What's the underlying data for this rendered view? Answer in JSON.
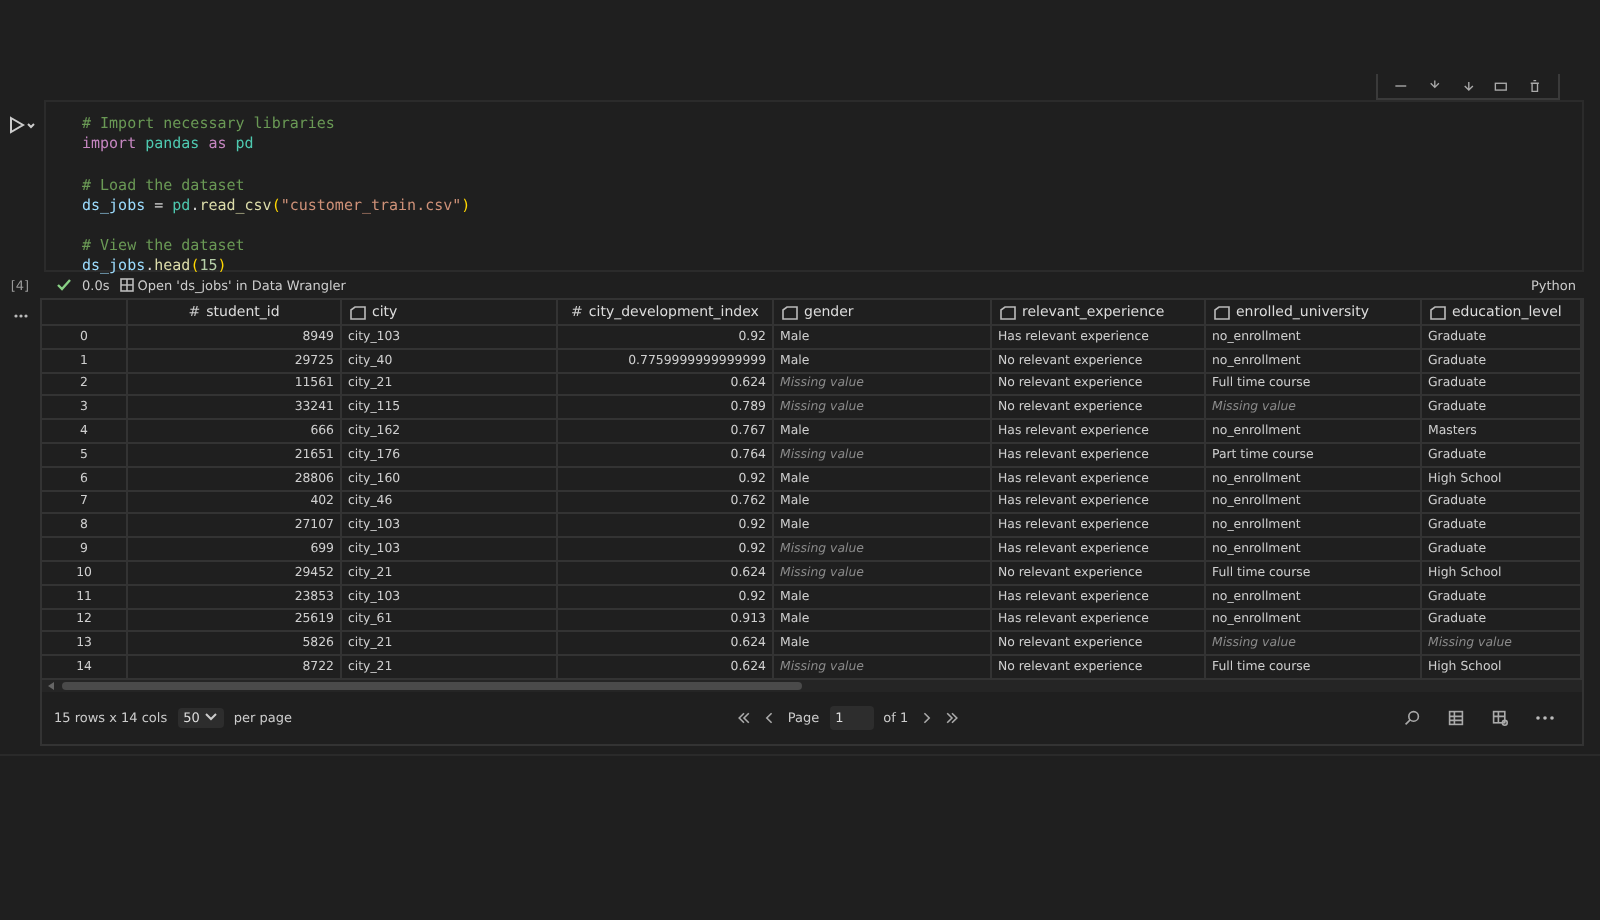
{
  "code_lines": [
    {
      "kind": "comment",
      "text": "# Import necessary libraries"
    },
    {
      "kind": "code",
      "parts": [
        {
          "kind": "kw",
          "s": "import "
        },
        {
          "kind": "mod",
          "s": "pandas"
        },
        {
          "kind": "kw",
          "s": " as "
        },
        {
          "kind": "mod",
          "s": "pd"
        }
      ]
    },
    {
      "kind": "blank"
    },
    {
      "kind": "comment",
      "text": "# Load the dataset"
    },
    {
      "kind": "code",
      "parts": [
        {
          "kind": "var",
          "s": "ds_jobs"
        },
        {
          "kind": "plain",
          "s": " = "
        },
        {
          "kind": "mod",
          "s": "pd"
        },
        {
          "kind": "plain",
          "s": "."
        },
        {
          "kind": "fn",
          "s": "read_csv"
        },
        {
          "kind": "paren",
          "s": "("
        },
        {
          "kind": "str",
          "s": "\"customer_train.csv\""
        },
        {
          "kind": "paren",
          "s": ")"
        }
      ]
    },
    {
      "kind": "blank"
    },
    {
      "kind": "comment",
      "text": "# View the dataset"
    },
    {
      "kind": "code",
      "parts": [
        {
          "kind": "var",
          "s": "ds_jobs"
        },
        {
          "kind": "plain",
          "s": "."
        },
        {
          "kind": "fn",
          "s": "head"
        },
        {
          "kind": "paren",
          "s": "("
        },
        {
          "kind": "num",
          "s": "15"
        },
        {
          "kind": "paren",
          "s": ")"
        }
      ]
    }
  ],
  "execution_count": "[4]",
  "duration": "0.0s",
  "wrangler_link": "Open 'ds_jobs' in Data Wrangler",
  "language": "Python",
  "columns": [
    {
      "name": "student_id",
      "kind": "number",
      "symbol": "#"
    },
    {
      "name": "city",
      "kind": "text"
    },
    {
      "name": "city_development_index",
      "kind": "number",
      "symbol": "#"
    },
    {
      "name": "gender",
      "kind": "text"
    },
    {
      "name": "relevant_experience",
      "kind": "text"
    },
    {
      "name": "enrolled_university",
      "kind": "text"
    },
    {
      "name": "education_level",
      "kind": "text"
    }
  ],
  "rows": [
    {
      "index": "0",
      "cells": [
        {
          "text": "8949",
          "missing": false
        },
        {
          "text": "city_103",
          "missing": false
        },
        {
          "text": "0.92",
          "missing": false
        },
        {
          "text": "Male",
          "missing": false
        },
        {
          "text": "Has relevant experience",
          "missing": false
        },
        {
          "text": "no_enrollment",
          "missing": false
        },
        {
          "text": "Graduate",
          "missing": false
        }
      ]
    },
    {
      "index": "1",
      "cells": [
        {
          "text": "29725",
          "missing": false
        },
        {
          "text": "city_40",
          "missing": false
        },
        {
          "text": "0.7759999999999999",
          "missing": false
        },
        {
          "text": "Male",
          "missing": false
        },
        {
          "text": "No relevant experience",
          "missing": false
        },
        {
          "text": "no_enrollment",
          "missing": false
        },
        {
          "text": "Graduate",
          "missing": false
        }
      ]
    },
    {
      "index": "2",
      "cells": [
        {
          "text": "11561",
          "missing": false
        },
        {
          "text": "city_21",
          "missing": false
        },
        {
          "text": "0.624",
          "missing": false
        },
        {
          "text": "Missing value",
          "missing": true
        },
        {
          "text": "No relevant experience",
          "missing": false
        },
        {
          "text": "Full time course",
          "missing": false
        },
        {
          "text": "Graduate",
          "missing": false
        }
      ]
    },
    {
      "index": "3",
      "cells": [
        {
          "text": "33241",
          "missing": false
        },
        {
          "text": "city_115",
          "missing": false
        },
        {
          "text": "0.789",
          "missing": false
        },
        {
          "text": "Missing value",
          "missing": true
        },
        {
          "text": "No relevant experience",
          "missing": false
        },
        {
          "text": "Missing value",
          "missing": true
        },
        {
          "text": "Graduate",
          "missing": false
        }
      ]
    },
    {
      "index": "4",
      "cells": [
        {
          "text": "666",
          "missing": false
        },
        {
          "text": "city_162",
          "missing": false
        },
        {
          "text": "0.767",
          "missing": false
        },
        {
          "text": "Male",
          "missing": false
        },
        {
          "text": "Has relevant experience",
          "missing": false
        },
        {
          "text": "no_enrollment",
          "missing": false
        },
        {
          "text": "Masters",
          "missing": false
        }
      ]
    },
    {
      "index": "5",
      "cells": [
        {
          "text": "21651",
          "missing": false
        },
        {
          "text": "city_176",
          "missing": false
        },
        {
          "text": "0.764",
          "missing": false
        },
        {
          "text": "Missing value",
          "missing": true
        },
        {
          "text": "Has relevant experience",
          "missing": false
        },
        {
          "text": "Part time course",
          "missing": false
        },
        {
          "text": "Graduate",
          "missing": false
        }
      ]
    },
    {
      "index": "6",
      "cells": [
        {
          "text": "28806",
          "missing": false
        },
        {
          "text": "city_160",
          "missing": false
        },
        {
          "text": "0.92",
          "missing": false
        },
        {
          "text": "Male",
          "missing": false
        },
        {
          "text": "Has relevant experience",
          "missing": false
        },
        {
          "text": "no_enrollment",
          "missing": false
        },
        {
          "text": "High School",
          "missing": false
        }
      ]
    },
    {
      "index": "7",
      "cells": [
        {
          "text": "402",
          "missing": false
        },
        {
          "text": "city_46",
          "missing": false
        },
        {
          "text": "0.762",
          "missing": false
        },
        {
          "text": "Male",
          "missing": false
        },
        {
          "text": "Has relevant experience",
          "missing": false
        },
        {
          "text": "no_enrollment",
          "missing": false
        },
        {
          "text": "Graduate",
          "missing": false
        }
      ]
    },
    {
      "index": "8",
      "cells": [
        {
          "text": "27107",
          "missing": false
        },
        {
          "text": "city_103",
          "missing": false
        },
        {
          "text": "0.92",
          "missing": false
        },
        {
          "text": "Male",
          "missing": false
        },
        {
          "text": "Has relevant experience",
          "missing": false
        },
        {
          "text": "no_enrollment",
          "missing": false
        },
        {
          "text": "Graduate",
          "missing": false
        }
      ]
    },
    {
      "index": "9",
      "cells": [
        {
          "text": "699",
          "missing": false
        },
        {
          "text": "city_103",
          "missing": false
        },
        {
          "text": "0.92",
          "missing": false
        },
        {
          "text": "Missing value",
          "missing": true
        },
        {
          "text": "Has relevant experience",
          "missing": false
        },
        {
          "text": "no_enrollment",
          "missing": false
        },
        {
          "text": "Graduate",
          "missing": false
        }
      ]
    },
    {
      "index": "10",
      "cells": [
        {
          "text": "29452",
          "missing": false
        },
        {
          "text": "city_21",
          "missing": false
        },
        {
          "text": "0.624",
          "missing": false
        },
        {
          "text": "Missing value",
          "missing": true
        },
        {
          "text": "No relevant experience",
          "missing": false
        },
        {
          "text": "Full time course",
          "missing": false
        },
        {
          "text": "High School",
          "missing": false
        }
      ]
    },
    {
      "index": "11",
      "cells": [
        {
          "text": "23853",
          "missing": false
        },
        {
          "text": "city_103",
          "missing": false
        },
        {
          "text": "0.92",
          "missing": false
        },
        {
          "text": "Male",
          "missing": false
        },
        {
          "text": "Has relevant experience",
          "missing": false
        },
        {
          "text": "no_enrollment",
          "missing": false
        },
        {
          "text": "Graduate",
          "missing": false
        }
      ]
    },
    {
      "index": "12",
      "cells": [
        {
          "text": "25619",
          "missing": false
        },
        {
          "text": "city_61",
          "missing": false
        },
        {
          "text": "0.913",
          "missing": false
        },
        {
          "text": "Male",
          "missing": false
        },
        {
          "text": "Has relevant experience",
          "missing": false
        },
        {
          "text": "no_enrollment",
          "missing": false
        },
        {
          "text": "Graduate",
          "missing": false
        }
      ]
    },
    {
      "index": "13",
      "cells": [
        {
          "text": "5826",
          "missing": false
        },
        {
          "text": "city_21",
          "missing": false
        },
        {
          "text": "0.624",
          "missing": false
        },
        {
          "text": "Male",
          "missing": false
        },
        {
          "text": "No relevant experience",
          "missing": false
        },
        {
          "text": "Missing value",
          "missing": true
        },
        {
          "text": "Missing value",
          "missing": true
        }
      ]
    },
    {
      "index": "14",
      "cells": [
        {
          "text": "8722",
          "missing": false
        },
        {
          "text": "city_21",
          "missing": false
        },
        {
          "text": "0.624",
          "missing": false
        },
        {
          "text": "Missing value",
          "missing": true
        },
        {
          "text": "No relevant experience",
          "missing": false
        },
        {
          "text": "Full time course",
          "missing": false
        },
        {
          "text": "High School",
          "missing": false
        }
      ]
    }
  ],
  "footer": {
    "summary": "15 rows x 14 cols",
    "page_size": "50",
    "per_page": "per page",
    "page_label": "Page",
    "page": "1",
    "of_pages": "of 1"
  }
}
